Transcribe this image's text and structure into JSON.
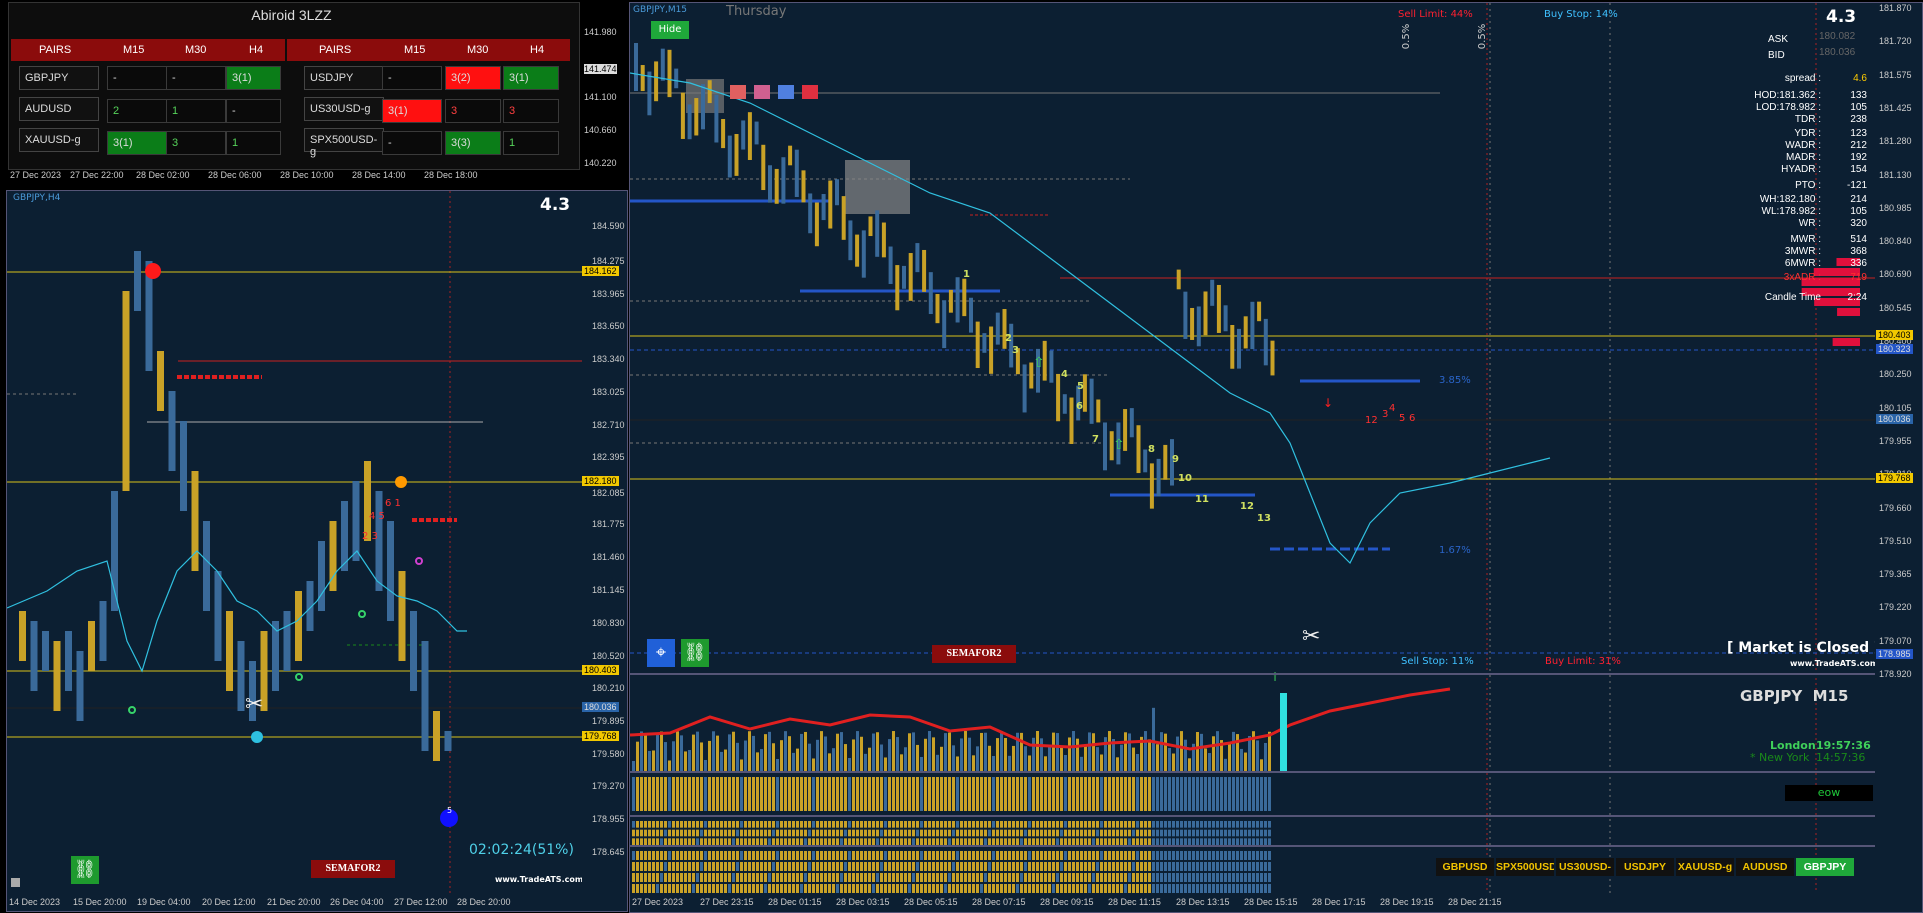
{
  "dashboard": {
    "title": "Abiroid 3LZZ",
    "headers": [
      "PAIRS",
      "M15",
      "M30",
      "H4",
      "PAIRS",
      "M15",
      "M30",
      "H4"
    ],
    "rows": [
      {
        "left": {
          "pair": "GBPJPY",
          "m15": "-",
          "m30": "-",
          "h4": "3(1)"
        },
        "right": {
          "pair": "USDJPY",
          "m15": "-",
          "m30": "3(2)",
          "h4": "3(1)"
        }
      },
      {
        "left": {
          "pair": "AUDUSD",
          "m15": "2",
          "m30": "1",
          "h4": "-"
        },
        "right": {
          "pair": "US30USD-g",
          "m15": "3(1)",
          "m30": "3",
          "h4": "3"
        }
      },
      {
        "left": {
          "pair": "XAUUSD-g",
          "m15": "3(1)",
          "m30": "3",
          "h4": "1"
        },
        "right": {
          "pair": "SPX500USD-g",
          "m15": "-",
          "m30": "3(3)",
          "h4": "1"
        }
      }
    ],
    "price_labels": [
      "141.980",
      "141.474",
      "141.100",
      "140.660",
      "140.220"
    ],
    "dates": [
      "27 Dec 2023",
      "27 Dec 22:00",
      "28 Dec 02:00",
      "28 Dec 06:00",
      "28 Dec 10:00",
      "28 Dec 14:00",
      "28 Dec 18:00"
    ]
  },
  "left_chart": {
    "title": "GBPJPY,H4",
    "score": "4.3",
    "timer": "02:02:24(51%)",
    "brand": "www.TradeATS.com",
    "semafor": "SEMAFOR2",
    "price_labels": [
      "184.590",
      "184.275",
      "183.965",
      "183.650",
      "183.340",
      "183.025",
      "182.710",
      "182.395",
      "182.085",
      "181.775",
      "181.460",
      "181.145",
      "180.830",
      "180.520",
      "180.210",
      "179.895",
      "179.580",
      "179.270",
      "178.955",
      "178.645"
    ],
    "tags": {
      "yellow_top": "184.162",
      "yellow_mid": "182.180",
      "yellow_low1": "180.403",
      "yellow_low2": "179.768",
      "current": "180.036"
    },
    "dates": [
      "14 Dec 2023",
      "15 Dec 20:00",
      "19 Dec 04:00",
      "20 Dec 12:00",
      "21 Dec 20:00",
      "26 Dec 04:00",
      "27 Dec 12:00",
      "28 Dec 20:00"
    ]
  },
  "right_chart": {
    "title": "GBPJPY,M15",
    "day": "Thursday",
    "hide_label": "Hide",
    "score": "4.3",
    "sell_limit": "Sell Limit: 44%",
    "buy_stop": "Buy Stop: 14%",
    "sell_stop": "Sell Stop: 11%",
    "buy_limit": "Buy Limit: 31%",
    "pct_top_left": "0.5%",
    "pct_top_right": "0.5%",
    "pct_385": "3.85%",
    "pct_167": "1.67%",
    "market_closed": "[ Market is Closed ]",
    "brand": "www.TradeATS.com",
    "semafor": "SEMAFOR2",
    "symbol_tf": "GBPJPY  M15",
    "sessions": [
      {
        "name": "London",
        "time": "19:57:36"
      },
      {
        "name": "* New York",
        "time": "14:57:36"
      }
    ],
    "eow": "eow",
    "price_labels": [
      "181.870",
      "181.720",
      "181.575",
      "181.425",
      "181.280",
      "181.130",
      "180.985",
      "180.840",
      "180.690",
      "180.545",
      "180.400",
      "180.250",
      "180.105",
      "179.955",
      "179.810",
      "179.660",
      "179.510",
      "179.365",
      "179.220",
      "179.070",
      "178.920"
    ],
    "tags": {
      "yellow1": "180.403",
      "blue1": "180.323",
      "current": "180.036",
      "yellow2": "179.768",
      "blue2": "178.985"
    },
    "wave_labels": [
      "1",
      "2",
      "3",
      "4",
      "5",
      "6",
      "7",
      "8",
      "9",
      "10",
      "11",
      "12",
      "13"
    ],
    "red_labels": [
      "12",
      "3",
      "4",
      "5",
      "6"
    ],
    "dates": [
      "27 Dec 2023",
      "27 Dec 23:15",
      "28 Dec 01:15",
      "28 Dec 03:15",
      "28 Dec 05:15",
      "28 Dec 07:15",
      "28 Dec 09:15",
      "28 Dec 11:15",
      "28 Dec 13:15",
      "28 Dec 15:15",
      "28 Dec 17:15",
      "28 Dec 19:15",
      "28 Dec 21:15"
    ],
    "symbols": [
      "GBPUSD",
      "SPX500USD-g",
      "US30USD-g",
      "USDJPY",
      "XAUUSD-g",
      "AUDUSD",
      "GBPJPY"
    ],
    "active_symbol": "GBPJPY",
    "stats": {
      "ask_label": "ASK",
      "ask": "180.082",
      "bid_label": "BID",
      "bid": "180.036",
      "rows": [
        {
          "k": "spread :",
          "v": "4.6"
        },
        {
          "k": "HOD:181.362 :",
          "v": "133"
        },
        {
          "k": "LOD:178.982 :",
          "v": "105"
        },
        {
          "k": "TDR :",
          "v": "238"
        },
        {
          "k": "YDR :",
          "v": "123"
        },
        {
          "k": "WADR :",
          "v": "212"
        },
        {
          "k": "MADR :",
          "v": "192"
        },
        {
          "k": "HYADR :",
          "v": "154"
        },
        {
          "k": "PTO :",
          "v": "-121"
        },
        {
          "k": "WH:182.180 :",
          "v": "214"
        },
        {
          "k": "WL:178.982 :",
          "v": "105"
        },
        {
          "k": "WR :",
          "v": "320"
        },
        {
          "k": "MWR :",
          "v": "514"
        },
        {
          "k": "3MWR :",
          "v": "368"
        },
        {
          "k": "6MWR :",
          "v": "336"
        },
        {
          "k": "3xADR :",
          "v": "719"
        },
        {
          "k": "Candle Time",
          "v": "2:24"
        }
      ]
    }
  }
}
